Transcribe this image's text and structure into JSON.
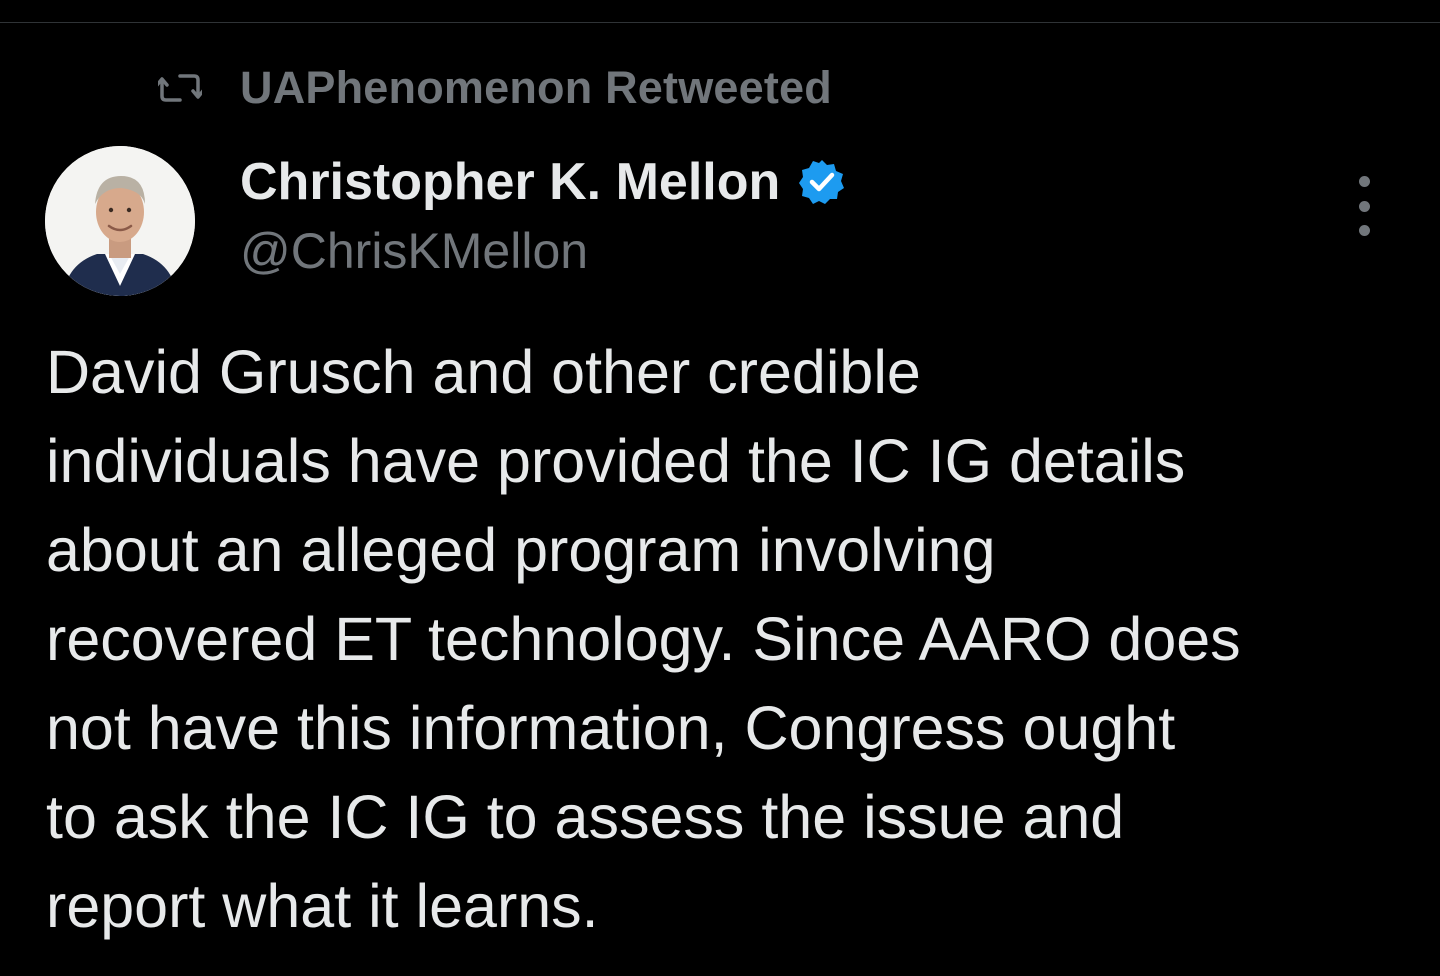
{
  "retweet": {
    "icon": "retweet-icon",
    "text": "UAPhenomenon Retweeted"
  },
  "author": {
    "display_name": "Christopher K. Mellon",
    "handle": "@ChrisKMellon",
    "verified_icon": "verified-badge-icon",
    "verified_color": "#1d9bf0"
  },
  "more_menu_icon": "more-vertical-icon",
  "tweet": {
    "lines": [
      "David Grusch and other credible",
      "individuals have provided the IC IG details",
      "about an alleged program involving",
      "recovered ET technology. Since AARO does",
      "not have this information, Congress ought",
      "to ask the IC IG to assess the issue and",
      "report what it learns."
    ]
  },
  "colors": {
    "background": "#000000",
    "primary_text": "#e7e9ea",
    "secondary_text": "#71767b",
    "accent": "#1d9bf0"
  }
}
